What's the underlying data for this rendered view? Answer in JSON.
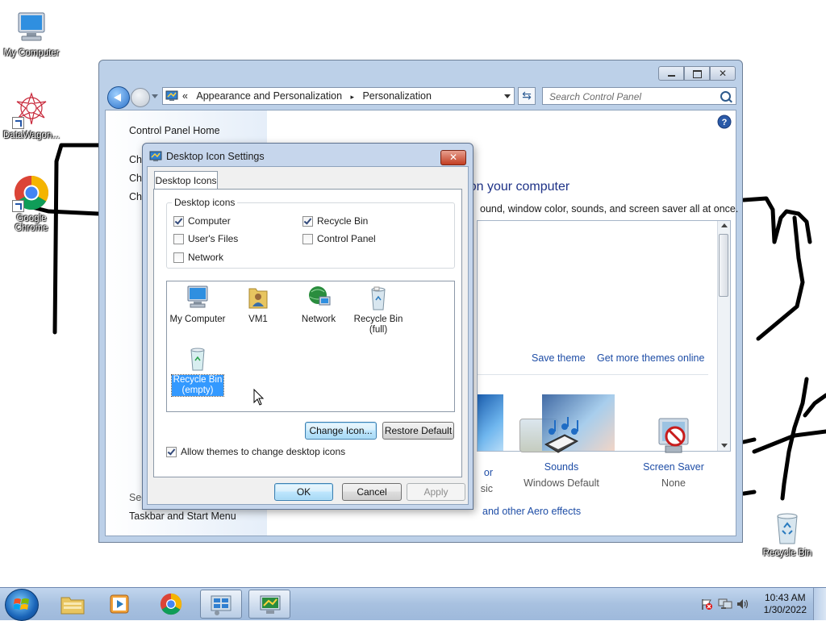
{
  "desktop": {
    "icons": [
      {
        "label": "My Computer"
      },
      {
        "label": "DataWagon..."
      },
      {
        "label": "Google Chrome"
      },
      {
        "label": "Recycle Bin"
      }
    ]
  },
  "control_panel": {
    "address": {
      "prefix": "«",
      "crumb1": "Appearance and Personalization",
      "sep": "▸",
      "crumb2": "Personalization"
    },
    "search_placeholder": "Search Control Panel",
    "left_links": {
      "home": "Control Panel Home",
      "ch1": "Ch",
      "ch2": "Ch",
      "ch3": "Ch",
      "see_also": "See",
      "taskbar": "Taskbar and Start Menu"
    },
    "title": "Change the visuals and sounds on your computer",
    "subtitle": "ound, window color, sounds, and screen saver all at once.",
    "save_theme": "Save theme",
    "more_themes": "Get more themes online",
    "settings": {
      "color_label": "or",
      "color_sub": "sic",
      "sounds_label": "Sounds",
      "sounds_sub": "Windows Default",
      "saver_label": "Screen Saver",
      "saver_sub": "None"
    },
    "aero_link": "and other Aero effects"
  },
  "dialog": {
    "title": "Desktop Icon Settings",
    "close": "✕",
    "tab": "Desktop Icons",
    "group_label": "Desktop icons",
    "checkboxes": [
      {
        "label": "Computer",
        "checked": true
      },
      {
        "label": "Recycle Bin",
        "checked": true
      },
      {
        "label": "User's Files",
        "checked": false
      },
      {
        "label": "Control Panel",
        "checked": false
      },
      {
        "label": "Network",
        "checked": false
      }
    ],
    "icon_list": [
      {
        "label": "My Computer"
      },
      {
        "label": "VM1"
      },
      {
        "label": "Network"
      },
      {
        "label": "Recycle Bin (full)",
        "line1": "Recycle Bin",
        "line2": "(full)"
      },
      {
        "label": "Recycle Bin (empty)",
        "line1": "Recycle Bin",
        "line2": "(empty)",
        "selected": true
      }
    ],
    "change_icon": "Change Icon...",
    "restore_default": "Restore Default",
    "allow_themes": {
      "label": "Allow themes to change desktop icons",
      "checked": true
    },
    "ok": "OK",
    "cancel": "Cancel",
    "apply": "Apply"
  },
  "taskbar": {
    "time": "10:43 AM",
    "date": "1/30/2022"
  }
}
